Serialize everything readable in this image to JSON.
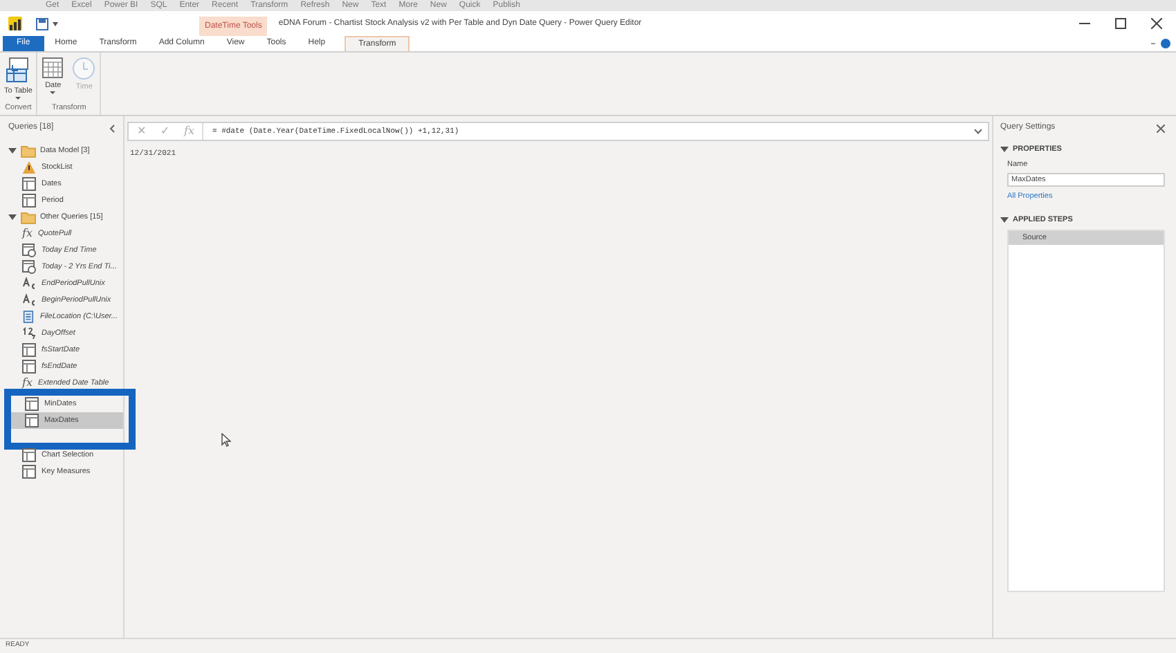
{
  "background_ribbon": [
    "Get",
    "Excel",
    "Power BI",
    "SQL",
    "Enter",
    "Recent",
    "Transform",
    "Refresh",
    "New",
    "Text",
    "More",
    "New",
    "Quick",
    "Publish"
  ],
  "window": {
    "title": "eDNA Forum - Chartist Stock Analysis v2 with Per Table and Dyn Date Query - Power Query Editor",
    "context_group": "DateTime Tools"
  },
  "tabs": [
    {
      "label": "File",
      "kind": "file",
      "selected": false
    },
    {
      "label": "Home",
      "kind": "tab",
      "selected": false
    },
    {
      "label": "Transform",
      "kind": "tab",
      "selected": false
    },
    {
      "label": "Add Column",
      "kind": "tab",
      "selected": false
    },
    {
      "label": "View",
      "kind": "tab",
      "selected": false
    },
    {
      "label": "Tools",
      "kind": "tab",
      "selected": false
    },
    {
      "label": "Help",
      "kind": "tab",
      "selected": false
    },
    {
      "label": "Transform",
      "kind": "context",
      "selected": true
    }
  ],
  "ribbon_groups": [
    {
      "label": "Convert",
      "buttons": [
        {
          "label": "To Table",
          "kind": "totable",
          "dropdown": true,
          "disabled": false
        }
      ]
    },
    {
      "label": "Transform",
      "buttons": [
        {
          "label": "Date",
          "kind": "date",
          "dropdown": true,
          "disabled": false
        },
        {
          "label": "Time",
          "kind": "time",
          "dropdown": false,
          "disabled": true
        }
      ]
    }
  ],
  "queries": {
    "title": "Queries [18]",
    "groups": [
      {
        "name": "Data Model [3]",
        "expanded": true,
        "items": [
          {
            "name": "StockList",
            "kind": "warning",
            "loaded": true,
            "selected": false
          },
          {
            "name": "Dates",
            "kind": "table",
            "loaded": true,
            "selected": false
          },
          {
            "name": "Period",
            "kind": "table",
            "loaded": true,
            "selected": false
          }
        ]
      },
      {
        "name": "Other Queries [15]",
        "expanded": true,
        "items": [
          {
            "name": "QuotePull",
            "kind": "function",
            "icon": "fx",
            "loaded": false,
            "selected": false
          },
          {
            "name": "Today End Time",
            "kind": "datetime",
            "loaded": false,
            "selected": false
          },
          {
            "name": "Today - 2 Yrs End Ti...",
            "kind": "datetime",
            "loaded": false,
            "selected": false
          },
          {
            "name": "EndPeriodPullUnix",
            "kind": "text",
            "loaded": false,
            "selected": false
          },
          {
            "name": "BeginPeriodPullUnix",
            "kind": "text",
            "loaded": false,
            "selected": false
          },
          {
            "name": "FileLocation (C:\\User...",
            "kind": "file",
            "loaded": false,
            "selected": false
          },
          {
            "name": "DayOffset",
            "kind": "number",
            "loaded": false,
            "selected": false
          },
          {
            "name": "fsStartDate",
            "kind": "table",
            "loaded": false,
            "selected": false
          },
          {
            "name": "fsEndDate",
            "kind": "table",
            "loaded": false,
            "selected": false
          },
          {
            "name": "Extended Date Table",
            "kind": "function",
            "icon": "fx",
            "loaded": false,
            "selected": false
          },
          {
            "name": "MinDates",
            "kind": "table",
            "loaded": true,
            "selected": false,
            "highlighted": true
          },
          {
            "name": "MaxDates",
            "kind": "table",
            "loaded": true,
            "selected": true,
            "highlighted": true
          },
          {
            "kind": "hidden",
            "highlighted": true
          },
          {
            "name": "Chart Selection",
            "kind": "table",
            "loaded": true,
            "selected": false
          },
          {
            "name": "Key Measures",
            "kind": "table",
            "loaded": true,
            "selected": false
          }
        ]
      }
    ]
  },
  "formula_bar": {
    "buttons": [
      "✕",
      "✓",
      "fx"
    ],
    "formula": "= #date (Date.Year(DateTime.FixedLocalNow()) +1,12,31)"
  },
  "result": "12/31/2021",
  "query_settings": {
    "title": "Query Settings",
    "properties_heading": "PROPERTIES",
    "name_label": "Name",
    "name_value": "MaxDates",
    "all_properties": "All Properties",
    "steps_heading": "APPLIED STEPS",
    "steps": [
      {
        "name": "Source",
        "selected": true
      }
    ]
  },
  "status_bar": "READY"
}
